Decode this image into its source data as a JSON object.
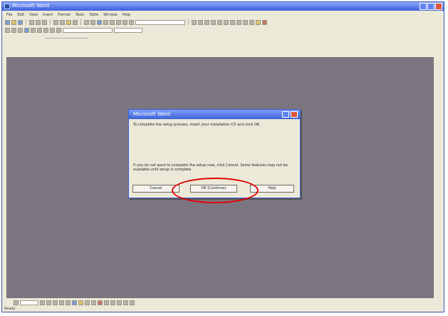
{
  "window": {
    "title": "Microsoft Word"
  },
  "menubar": {
    "items": [
      "File",
      "Edit",
      "View",
      "Insert",
      "Format",
      "Tools",
      "Table",
      "Window",
      "Help"
    ]
  },
  "dialog": {
    "title": "Microsoft Word",
    "message": "To complete the setup process, insert your installation CD and click OK.",
    "message2": "If you do not want to complete the setup now, click Cancel. Some features may not be available until setup is complete.",
    "buttons": [
      "Cancel",
      "OK (Continue)",
      "Help"
    ]
  },
  "highlight": {
    "color": "#e10000"
  },
  "status": {
    "text": "Ready"
  }
}
